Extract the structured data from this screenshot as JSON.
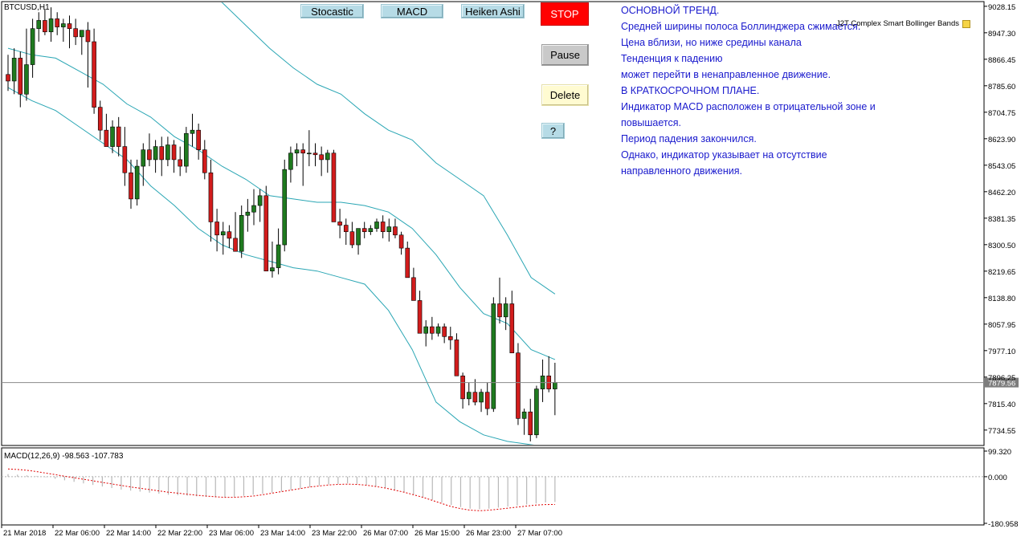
{
  "window": {
    "symbol_label": "BTCUSD,H1",
    "macd_label": "MACD(12,26,9) -98.563 -107.783",
    "indicator_name": "J2T Complex Smart Bollinger Bands"
  },
  "toolbar": {
    "stocastic_label": "Stocastic",
    "macd_label": "MACD",
    "heiken_label": "Heiken Ashi",
    "stop_label": "STOP",
    "pause_label": "Pause",
    "delete_label": "Delete",
    "help_label": "?"
  },
  "comment_lines": [
    "ОСНОВНОЙ ТРЕНД.",
    "Средней ширины полоса Боллинджера сжимается.",
    "Цена вблизи, но ниже средины канала",
    "Тенденция к падению",
    "может перейти в ненаправленное движение.",
    "В КРАТКОСРОЧНОМ ПЛАНЕ.",
    "Индикатор MACD расположен в отрицательной зоне и",
    "повышается.",
    "Период падения закончился.",
    "Однако, индикатор указывает на отсутствие",
    "направленного движения."
  ],
  "colors": {
    "bull": "#1f7a1f",
    "bear": "#d21c1c",
    "bands": "#2aa6b4",
    "signal": "#e00000",
    "histogram": "#b8b8b8",
    "text": "#1a1acd",
    "current_price_badge": "#7d7d7d"
  },
  "chart_data": [
    {
      "type": "candlestick",
      "title": "BTCUSD,H1",
      "price_ticks": [
        "9028.15",
        "8947.30",
        "8866.45",
        "8785.60",
        "8704.75",
        "8623.90",
        "8543.05",
        "8462.20",
        "8381.35",
        "8300.50",
        "8219.65",
        "8138.80",
        "8057.95",
        "7977.10",
        "7896.25",
        "7815.40",
        "7734.55"
      ],
      "ylim": [
        7690,
        9040
      ],
      "current_price": "7879.56",
      "time_ticks": [
        "21 Mar 2018",
        "22 Mar 06:00",
        "22 Mar 14:00",
        "22 Mar 22:00",
        "23 Mar 06:00",
        "23 Mar 14:00",
        "23 Mar 22:00",
        "26 Mar 07:00",
        "26 Mar 15:00",
        "26 Mar 23:00",
        "27 Mar 07:00"
      ],
      "ohlc": [
        [
          8820,
          8880,
          8770,
          8800
        ],
        [
          8800,
          8900,
          8760,
          8870
        ],
        [
          8870,
          8890,
          8720,
          8760
        ],
        [
          8760,
          8960,
          8740,
          8850
        ],
        [
          8850,
          8990,
          8810,
          8960
        ],
        [
          8960,
          9010,
          8920,
          8985
        ],
        [
          8985,
          9020,
          8940,
          8950
        ],
        [
          8950,
          9025,
          8920,
          8990
        ],
        [
          8990,
          9010,
          8940,
          8965
        ],
        [
          8965,
          8990,
          8920,
          8975
        ],
        [
          8975,
          9000,
          8900,
          8960
        ],
        [
          8960,
          8990,
          8910,
          8935
        ],
        [
          8935,
          8950,
          8880,
          8955
        ],
        [
          8955,
          8980,
          8780,
          8920
        ],
        [
          8920,
          8960,
          8700,
          8720
        ],
        [
          8720,
          8740,
          8620,
          8650
        ],
        [
          8650,
          8700,
          8600,
          8600
        ],
        [
          8600,
          8680,
          8580,
          8660
        ],
        [
          8660,
          8690,
          8570,
          8600
        ],
        [
          8600,
          8660,
          8480,
          8520
        ],
        [
          8520,
          8560,
          8410,
          8440
        ],
        [
          8440,
          8560,
          8420,
          8540
        ],
        [
          8540,
          8610,
          8480,
          8590
        ],
        [
          8590,
          8640,
          8540,
          8560
        ],
        [
          8560,
          8620,
          8520,
          8600
        ],
        [
          8600,
          8630,
          8510,
          8560
        ],
        [
          8560,
          8630,
          8540,
          8605
        ],
        [
          8605,
          8620,
          8520,
          8560
        ],
        [
          8560,
          8600,
          8510,
          8540
        ],
        [
          8540,
          8660,
          8520,
          8640
        ],
        [
          8640,
          8700,
          8600,
          8650
        ],
        [
          8650,
          8670,
          8560,
          8590
        ],
        [
          8590,
          8620,
          8500,
          8520
        ],
        [
          8520,
          8560,
          8310,
          8370
        ],
        [
          8370,
          8410,
          8280,
          8330
        ],
        [
          8330,
          8370,
          8270,
          8340
        ],
        [
          8340,
          8360,
          8290,
          8320
        ],
        [
          8320,
          8400,
          8280,
          8280
        ],
        [
          8280,
          8420,
          8260,
          8390
        ],
        [
          8390,
          8440,
          8340,
          8400
        ],
        [
          8400,
          8470,
          8360,
          8420
        ],
        [
          8420,
          8470,
          8370,
          8450
        ],
        [
          8450,
          8480,
          8290,
          8220
        ],
        [
          8220,
          8310,
          8200,
          8230
        ],
        [
          8230,
          8350,
          8210,
          8300
        ],
        [
          8300,
          8560,
          8280,
          8530
        ],
        [
          8530,
          8600,
          8490,
          8580
        ],
        [
          8580,
          8610,
          8540,
          8590
        ],
        [
          8590,
          8610,
          8480,
          8580
        ],
        [
          8580,
          8650,
          8540,
          8580
        ],
        [
          8580,
          8610,
          8540,
          8575
        ],
        [
          8575,
          8600,
          8510,
          8560
        ],
        [
          8560,
          8590,
          8520,
          8580
        ],
        [
          8580,
          8590,
          8510,
          8370
        ],
        [
          8370,
          8410,
          8320,
          8360
        ],
        [
          8360,
          8380,
          8300,
          8340
        ],
        [
          8340,
          8370,
          8290,
          8300
        ],
        [
          8300,
          8350,
          8270,
          8350
        ],
        [
          8350,
          8370,
          8320,
          8340
        ],
        [
          8340,
          8360,
          8330,
          8350
        ],
        [
          8350,
          8380,
          8340,
          8370
        ],
        [
          8370,
          8390,
          8320,
          8340
        ],
        [
          8340,
          8380,
          8310,
          8355
        ],
        [
          8355,
          8380,
          8320,
          8330
        ],
        [
          8330,
          8340,
          8270,
          8290
        ],
        [
          8290,
          8310,
          8220,
          8200
        ],
        [
          8200,
          8230,
          8140,
          8130
        ],
        [
          8130,
          8160,
          8050,
          8030
        ],
        [
          8030,
          8070,
          7990,
          8050
        ],
        [
          8050,
          8080,
          8010,
          8030
        ],
        [
          8030,
          8060,
          8020,
          8050
        ],
        [
          8050,
          8060,
          8000,
          8020
        ],
        [
          8020,
          8050,
          7980,
          8010
        ],
        [
          8010,
          8030,
          7960,
          7900
        ],
        [
          7900,
          7910,
          7800,
          7830
        ],
        [
          7830,
          7880,
          7810,
          7850
        ],
        [
          7850,
          7890,
          7810,
          7820
        ],
        [
          7820,
          7860,
          7790,
          7850
        ],
        [
          7850,
          7880,
          7780,
          7800
        ],
        [
          7800,
          8140,
          7790,
          8120
        ],
        [
          8120,
          8200,
          8060,
          8080
        ],
        [
          8080,
          8140,
          8040,
          8120
        ],
        [
          8120,
          8160,
          7980,
          7970
        ],
        [
          7970,
          8000,
          7750,
          7770
        ],
        [
          7770,
          7800,
          7720,
          7790
        ],
        [
          7790,
          7830,
          7700,
          7720
        ],
        [
          7720,
          7870,
          7710,
          7860
        ],
        [
          7860,
          7950,
          7820,
          7900
        ],
        [
          7900,
          7960,
          7850,
          7860
        ],
        [
          7860,
          7940,
          7780,
          7880
        ]
      ],
      "bands": {
        "upper": [
          9420,
          9350,
          9300,
          9260,
          9240,
          9210,
          9150,
          9090,
          9070,
          9040,
          8970,
          8900,
          8840,
          8790,
          8760,
          8700,
          8650,
          8620,
          8550,
          8500,
          8450,
          8330,
          8200,
          8150
        ],
        "middle": [
          8900,
          8880,
          8870,
          8830,
          8790,
          8730,
          8690,
          8630,
          8590,
          8540,
          8500,
          8450,
          8440,
          8430,
          8430,
          8420,
          8400,
          8350,
          8270,
          8170,
          8090,
          8060,
          7980,
          7950
        ],
        "lower": [
          8780,
          8740,
          8710,
          8660,
          8610,
          8560,
          8480,
          8420,
          8350,
          8300,
          8270,
          8250,
          8230,
          8220,
          8200,
          8180,
          8100,
          7980,
          7820,
          7760,
          7720,
          7700,
          7690,
          7680
        ]
      }
    },
    {
      "type": "macd",
      "title": "MACD(12,26,9) -98.563 -107.783",
      "ticks": [
        "99.320",
        "0.000",
        "-180.958"
      ],
      "ylim": [
        -180.958,
        99.32
      ],
      "histogram": [
        10,
        8,
        5,
        2,
        -2,
        -8,
        -14,
        -20,
        -26,
        -32,
        -38,
        -44,
        -50,
        -54,
        -58,
        -62,
        -66,
        -70,
        -72,
        -74,
        -76,
        -78,
        -80,
        -80,
        -78,
        -74,
        -70,
        -66,
        -62,
        -58,
        -52,
        -46,
        -40,
        -34,
        -30,
        -28,
        -26,
        -28,
        -32,
        -38,
        -45,
        -52,
        -60,
        -70,
        -80,
        -90,
        -100,
        -110,
        -118,
        -124,
        -126,
        -124,
        -120,
        -116,
        -112,
        -108,
        -104,
        -100,
        -98
      ],
      "signal": [
        30,
        28,
        25,
        20,
        14,
        8,
        2,
        -4,
        -10,
        -16,
        -22,
        -28,
        -34,
        -40,
        -45,
        -50,
        -55,
        -60,
        -64,
        -68,
        -72,
        -75,
        -78,
        -80,
        -80,
        -78,
        -75,
        -70,
        -64,
        -58,
        -52,
        -46,
        -40,
        -36,
        -32,
        -30,
        -29,
        -30,
        -33,
        -38,
        -44,
        -52,
        -60,
        -70,
        -80,
        -92,
        -104,
        -116,
        -124,
        -130,
        -132,
        -130,
        -126,
        -122,
        -118,
        -114,
        -110,
        -108,
        -107.783
      ]
    }
  ]
}
